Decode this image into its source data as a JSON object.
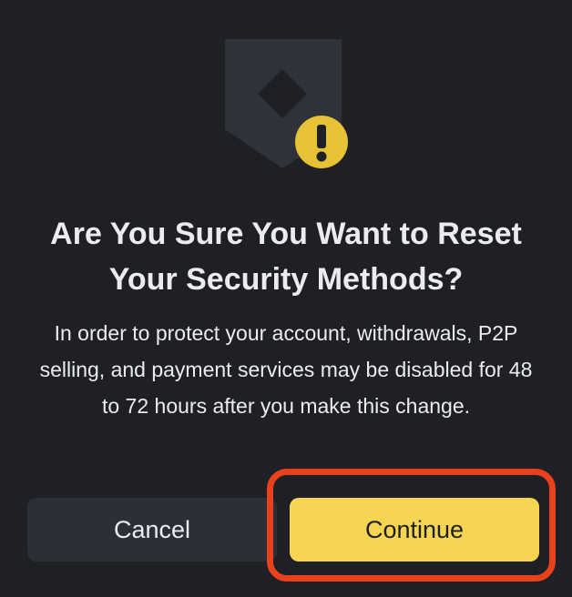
{
  "dialog": {
    "title": "Are You Sure You Want to Reset Your Security Methods?",
    "message": "In order to protect your account, withdrawals, P2P selling, and payment services may be disabled for 48 to 72 hours after you make this change.",
    "cancel_label": "Cancel",
    "continue_label": "Continue",
    "icons": {
      "hero": "shield-icon",
      "warning": "warning-icon"
    }
  },
  "colors": {
    "background": "#1e2026",
    "text": "#eaecef",
    "shield": "#2f3239",
    "shield_diamond": "#1e2026",
    "warning_badge": "#e7c234",
    "primary_button": "#f5d552",
    "secondary_button": "#2b2f36",
    "highlight": "#e9411c"
  }
}
